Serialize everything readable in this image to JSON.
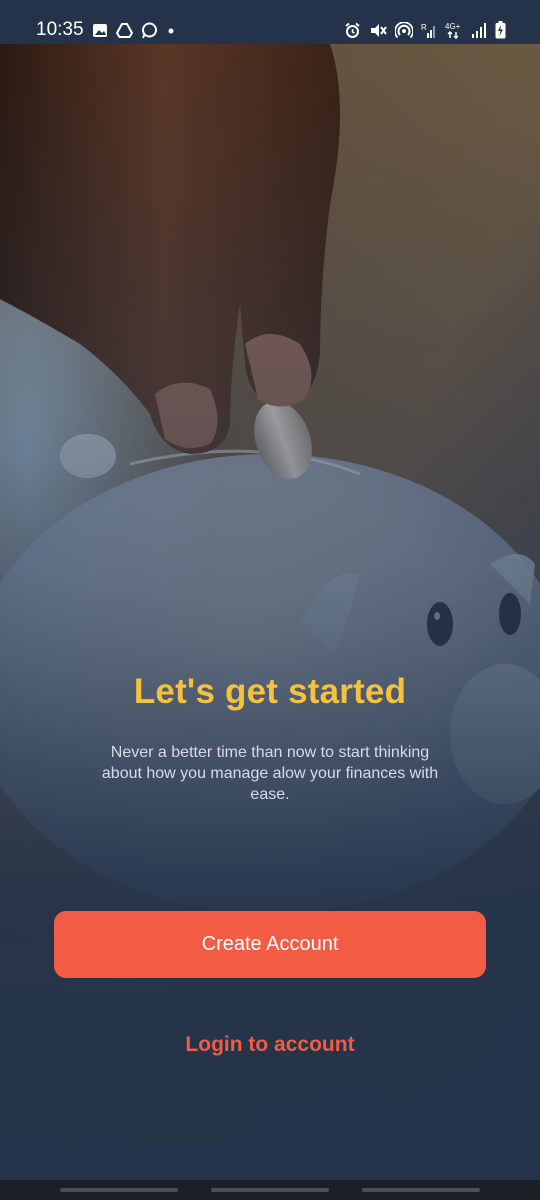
{
  "status_bar": {
    "time": "10:35",
    "left_icons": [
      "gallery-icon",
      "drive-icon",
      "whatsapp-icon",
      "notification-dot-icon"
    ],
    "right_icons": [
      "alarm-icon",
      "mute-icon",
      "hotspot-icon",
      "signal-r-icon",
      "network-4g-icon",
      "signal-icon",
      "battery-charging-icon"
    ],
    "network_label": "4G+"
  },
  "hero": {
    "image": "hand-dropping-coin-into-piggy-bank"
  },
  "onboarding": {
    "title": "Let's get started",
    "subtitle": "Never a better time than now to  start thinking about how you manage alow your finances with ease.",
    "create_account_label": "Create Account",
    "login_label": "Login to account"
  },
  "colors": {
    "title": "#f6c23c",
    "primary_button": "#f25b44",
    "background": "#243349",
    "subtitle": "#d6dce6"
  }
}
